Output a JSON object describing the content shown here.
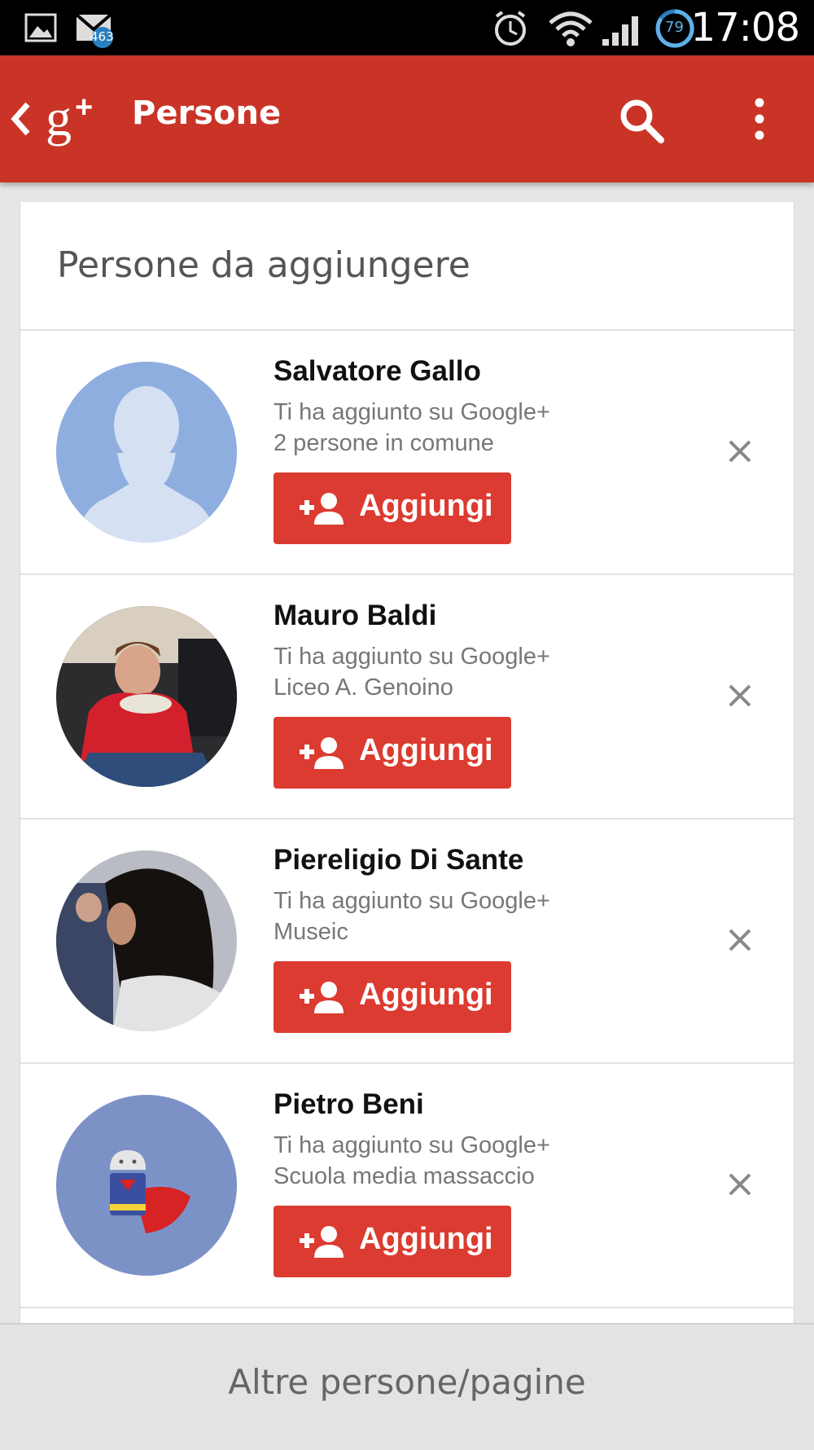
{
  "status_bar": {
    "time": "17:08",
    "gmail_count": "463",
    "battery_level": "79",
    "icons": [
      "gallery-icon",
      "gmail-icon",
      "alarm-icon",
      "wifi-icon",
      "signal-icon",
      "battery-icon"
    ]
  },
  "app_bar": {
    "title": "Persone",
    "colors": {
      "background": "#c93426"
    }
  },
  "card": {
    "title": "Persone da aggiungere"
  },
  "people": [
    {
      "name": "Salvatore Gallo",
      "line1": "Ti ha aggiunto su Google+",
      "line2": "2 persone in comune",
      "button": "Aggiungi",
      "avatar": "default-silhouette"
    },
    {
      "name": "Mauro Baldi",
      "line1": "Ti ha aggiunto su Google+",
      "line2": "Liceo A. Genoino",
      "button": "Aggiungi",
      "avatar": "photo"
    },
    {
      "name": "Piereligio Di Sante",
      "line1": "Ti ha aggiunto su Google+",
      "line2": "Museic",
      "button": "Aggiungi",
      "avatar": "photo"
    },
    {
      "name": "Pietro Beni",
      "line1": "Ti ha aggiunto su Google+",
      "line2": "Scuola media massaccio",
      "button": "Aggiungi",
      "avatar": "android-superhero"
    }
  ],
  "bottom": {
    "label": "Altre persone/pagine"
  },
  "colors": {
    "accent_button": "#db3b30",
    "app_bar": "#c93426",
    "background": "#e6e6e6"
  }
}
